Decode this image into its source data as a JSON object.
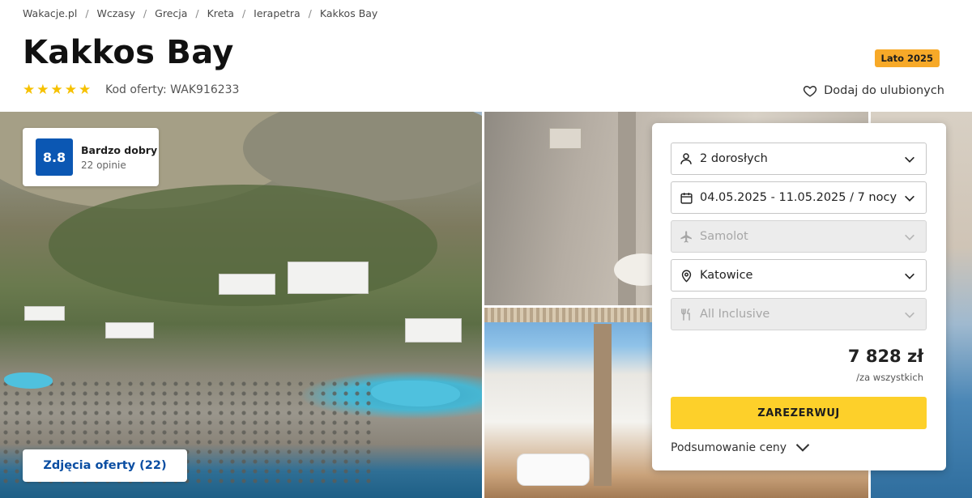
{
  "breadcrumb": [
    "Wakacje.pl",
    "Wczasy",
    "Grecja",
    "Kreta",
    "Ierapetra",
    "Kakkos Bay"
  ],
  "hotel": {
    "name": "Kakkos Bay",
    "season_badge": "Lato 2025",
    "stars": 5,
    "offer_code": "Kod oferty: WAK916233"
  },
  "favorite_label": "Dodaj do ulubionych",
  "rating": {
    "score": "8.8",
    "label": "Bardzo dobry",
    "reviews": "22 opinie"
  },
  "photos_button": "Zdjęcia oferty (22)",
  "booking": {
    "travelers": "2 dorosłych",
    "dates": "04.05.2025 - 11.05.2025 / 7 nocy",
    "transport": "Samolot",
    "departure": "Katowice",
    "board": "All Inclusive",
    "price": "7 828 zł",
    "price_note": "/za wszystkich",
    "book_button": "ZAREZERWUJ",
    "summary_link": "Podsumowanie ceny"
  },
  "colors": {
    "rating_badge": "#0b57b3",
    "season_badge": "#f7a928",
    "book_button": "#fdd02a",
    "star": "#f6c100",
    "link": "#0b4ea2"
  },
  "icons": [
    "heart-icon",
    "person-icon",
    "calendar-icon",
    "plane-icon",
    "location-pin-icon",
    "cutlery-icon",
    "chevron-down-icon"
  ]
}
